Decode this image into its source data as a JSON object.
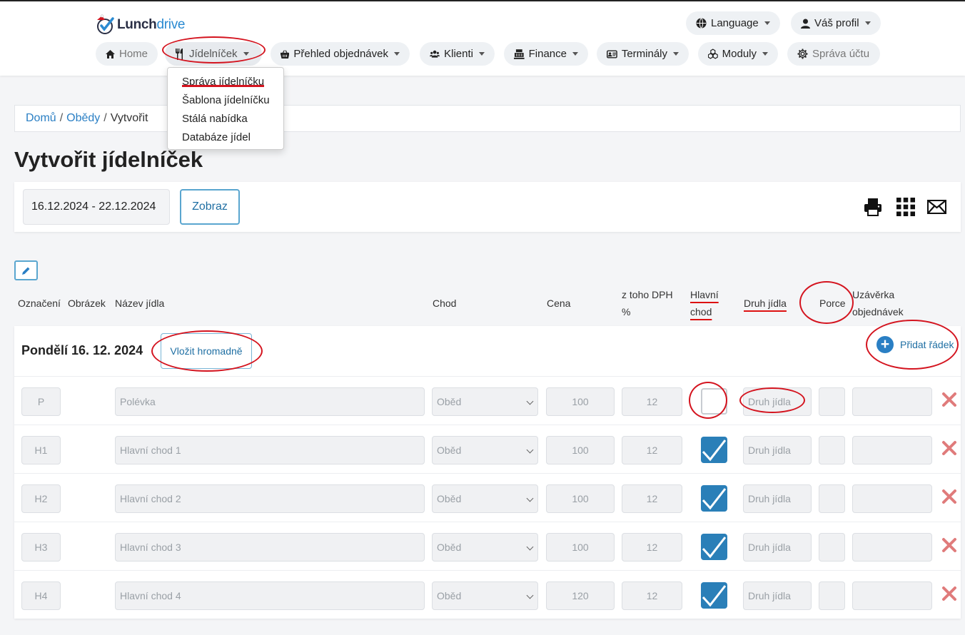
{
  "brand": {
    "name_part1": "Lunch",
    "name_part2": "drive"
  },
  "header": {
    "language": "Language",
    "profile": "Váš profil"
  },
  "nav": [
    {
      "label": "Home",
      "icon": "home-icon"
    },
    {
      "label": "Jídelníček",
      "icon": "cutlery-icon"
    },
    {
      "label": "Přehled objednávek",
      "icon": "basket-icon"
    },
    {
      "label": "Klienti",
      "icon": "users-icon"
    },
    {
      "label": "Finance",
      "icon": "cash-register-icon"
    },
    {
      "label": "Terminály",
      "icon": "terminal-icon"
    },
    {
      "label": "Moduly",
      "icon": "cubes-icon"
    },
    {
      "label": "Správa účtu",
      "icon": "gear-icon"
    }
  ],
  "dropdown": [
    "Správa jídelníčku",
    "Šablona jídelníčku",
    "Stálá nabídka",
    "Databáze jídel"
  ],
  "breadcrumb": {
    "home": "Domů",
    "section": "Obědy",
    "current": "Vytvořit"
  },
  "page_title": "Vytvořit jídelníček",
  "toolbar": {
    "date_range": "16.12.2024 - 22.12.2024",
    "show_button": "Zobraz"
  },
  "columns": {
    "code": "Označení",
    "image": "Obrázek",
    "name": "Název jídla",
    "course": "Chod",
    "price": "Cena",
    "vat_line1": "z toho DPH",
    "vat_line2": "%",
    "main_line1": "Hlavní",
    "main_line2": "chod",
    "type": "Druh jídla",
    "portions": "Porce",
    "cutoff_line1": "Uzávěrka",
    "cutoff_line2": "objednávek"
  },
  "day": {
    "title": "Pondělí 16. 12. 2024",
    "bulk_button": "Vložit hromadně",
    "add_row": "Přidat řádek",
    "rows": [
      {
        "code": "P",
        "name": "Polévka",
        "course": "Oběd",
        "price": "100",
        "vat": "12",
        "main": false,
        "type_placeholder": "Druh jídla"
      },
      {
        "code": "H1",
        "name": "Hlavní chod 1",
        "course": "Oběd",
        "price": "100",
        "vat": "12",
        "main": true,
        "type_placeholder": "Druh jídla"
      },
      {
        "code": "H2",
        "name": "Hlavní chod 2",
        "course": "Oběd",
        "price": "100",
        "vat": "12",
        "main": true,
        "type_placeholder": "Druh jídla"
      },
      {
        "code": "H3",
        "name": "Hlavní chod 3",
        "course": "Oběd",
        "price": "100",
        "vat": "12",
        "main": true,
        "type_placeholder": "Druh jídla"
      },
      {
        "code": "H4",
        "name": "Hlavní chod 4",
        "course": "Oběd",
        "price": "120",
        "vat": "12",
        "main": true,
        "type_placeholder": "Druh jídla"
      }
    ]
  },
  "colors": {
    "accent": "#2a7fc4",
    "annotation": "#d4141f",
    "checkbox": "#2a7fb8",
    "delete": "#e07b7b"
  }
}
